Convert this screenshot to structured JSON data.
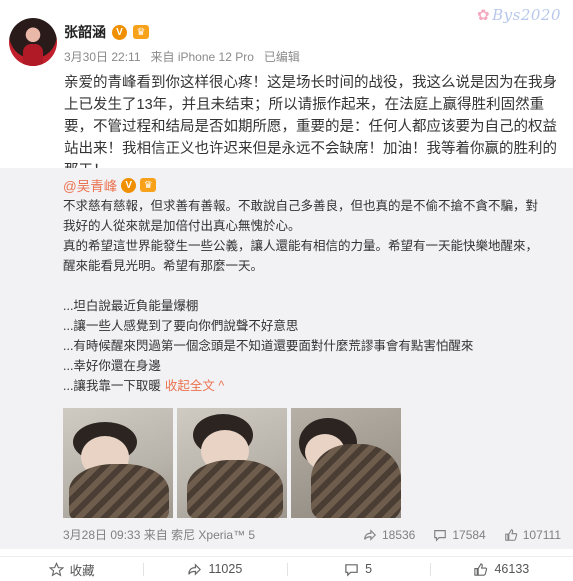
{
  "watermark": "Bys2020",
  "post": {
    "author": "张韶涵",
    "timestamp": "3月30日 22:11",
    "source": "来自 iPhone 12 Pro",
    "edited": "已编辑",
    "text": "亲爱的青峰看到你这样很心疼！这是场长时间的战役，我这么说是因为在我身上已发生了13年，并且未结束；所以请振作起来，在法庭上赢得胜利固然重要，不管过程和结局是否如期所愿，重要的是：任何人都应该要为自己的权益站出来！我相信正义也许迟来但是永远不会缺席！加油！我等着你赢的胜利的那天！"
  },
  "repost": {
    "author": "@吴青峰",
    "paragraphs": [
      "不求慈有慈報，但求善有善報。不敢說自己多善良，但也真的是不偷不搶不貪不騙，對我好的人從來就是加倍付出真心無愧於心。",
      "真的希望這世界能發生一些公義，讓人還能有相信的力量。希望有一天能快樂地醒來，醒來能看見光明。希望有那麼一天。"
    ],
    "lines": [
      "...坦白說最近負能量爆棚",
      "...讓一些人感覺到了要向你們說聲不好意思",
      "...有時候醒來閃過第一個念頭是不知道還要面對什麼荒謬事會有點害怕醒來",
      "...幸好你還在身邊",
      "...讓我靠一下取暖"
    ],
    "collapse_label": "收起全文 ^",
    "timestamp": "3月28日 09:33",
    "source": "来自 索尼 Xperia™ 5",
    "stats": {
      "reposts": "18536",
      "comments": "17584",
      "likes": "107111"
    }
  },
  "actions": {
    "favorite": "收藏",
    "repost": "11025",
    "comment": "5",
    "like": "46133"
  },
  "colors": {
    "accent": "#eb7350",
    "repost_bg": "#f2f2f5",
    "verified": "#f09000"
  }
}
